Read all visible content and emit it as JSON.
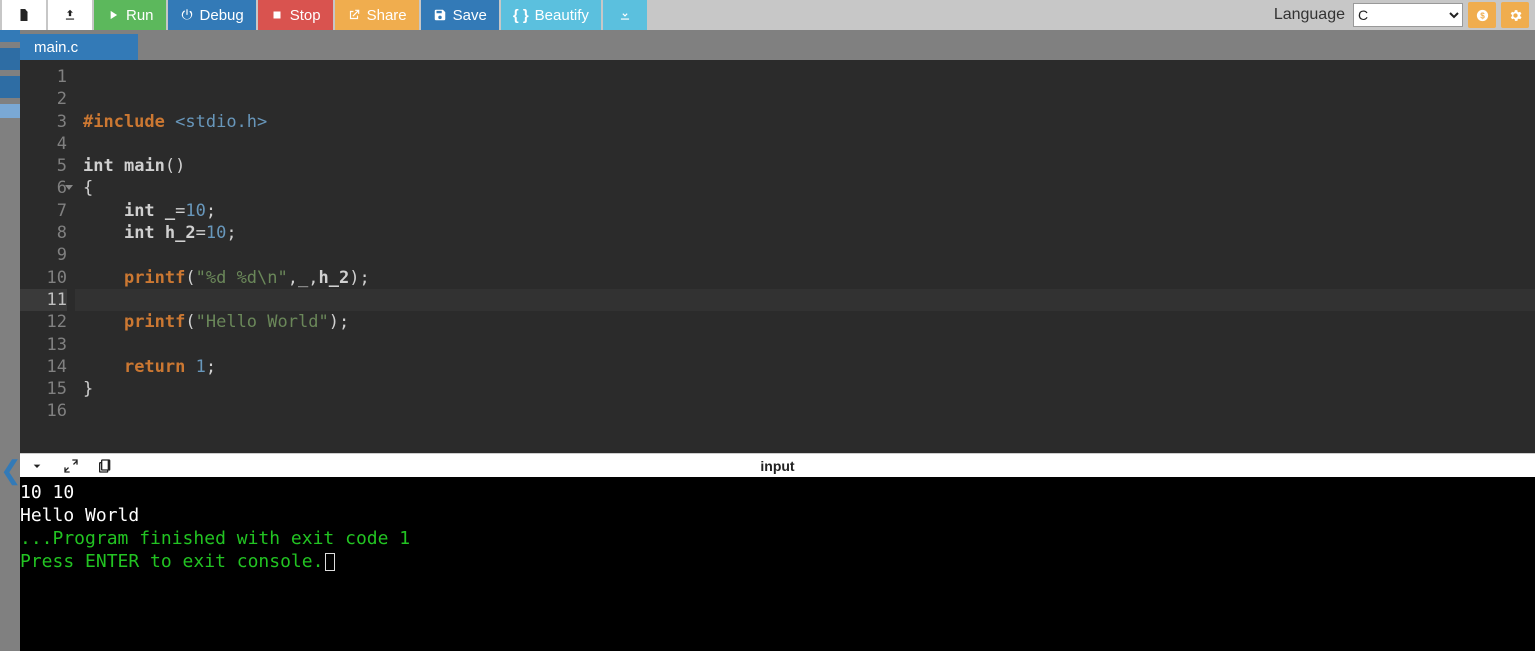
{
  "toolbar": {
    "run": "Run",
    "debug": "Debug",
    "stop": "Stop",
    "share": "Share",
    "save": "Save",
    "beautify": "Beautify",
    "language_label": "Language",
    "language_selected": "C"
  },
  "tabs": {
    "active": "main.c"
  },
  "editor": {
    "lines": [
      {
        "n": 1,
        "html": ""
      },
      {
        "n": 2,
        "html": ""
      },
      {
        "n": 3,
        "html": "<span class='tok-include'>#include</span> <span class='tok-header'>&lt;stdio.h&gt;</span>"
      },
      {
        "n": 4,
        "html": ""
      },
      {
        "n": 5,
        "html": "<span class='tok-type'>int</span> <span class='tok-id'>main</span><span class='tok-paren'>()</span>"
      },
      {
        "n": 6,
        "html": "<span class='tok-paren'>{</span>",
        "fold": true
      },
      {
        "n": 7,
        "html": "    <span class='tok-type'>int</span> <span class='tok-id'>_</span><span class='tok-plain'>=</span><span class='tok-num'>10</span><span class='tok-plain'>;</span>"
      },
      {
        "n": 8,
        "html": "    <span class='tok-type'>int</span> <span class='tok-id'>h_2</span><span class='tok-plain'>=</span><span class='tok-num'>10</span><span class='tok-plain'>;</span>"
      },
      {
        "n": 9,
        "html": ""
      },
      {
        "n": 10,
        "html": "    <span class='tok-func'>printf</span><span class='tok-paren'>(</span><span class='tok-str'>\"%d %d\\n\"</span><span class='tok-plain'>,_,</span><span class='tok-id'>h_2</span><span class='tok-paren'>)</span><span class='tok-plain'>;</span>"
      },
      {
        "n": 11,
        "html": "",
        "active": true
      },
      {
        "n": 12,
        "html": "    <span class='tok-func'>printf</span><span class='tok-paren'>(</span><span class='tok-str'>\"Hello World\"</span><span class='tok-paren'>)</span><span class='tok-plain'>;</span>"
      },
      {
        "n": 13,
        "html": ""
      },
      {
        "n": 14,
        "html": "    <span class='tok-kw'>return</span> <span class='tok-num'>1</span><span class='tok-plain'>;</span>"
      },
      {
        "n": 15,
        "html": "<span class='tok-paren'>}</span>"
      },
      {
        "n": 16,
        "html": ""
      }
    ]
  },
  "splitbar": {
    "label": "input"
  },
  "console": {
    "out1": "10 10",
    "out2": "Hello World",
    "blank": "",
    "exit1": "...Program finished with exit code 1",
    "exit2": "Press ENTER to exit console."
  }
}
